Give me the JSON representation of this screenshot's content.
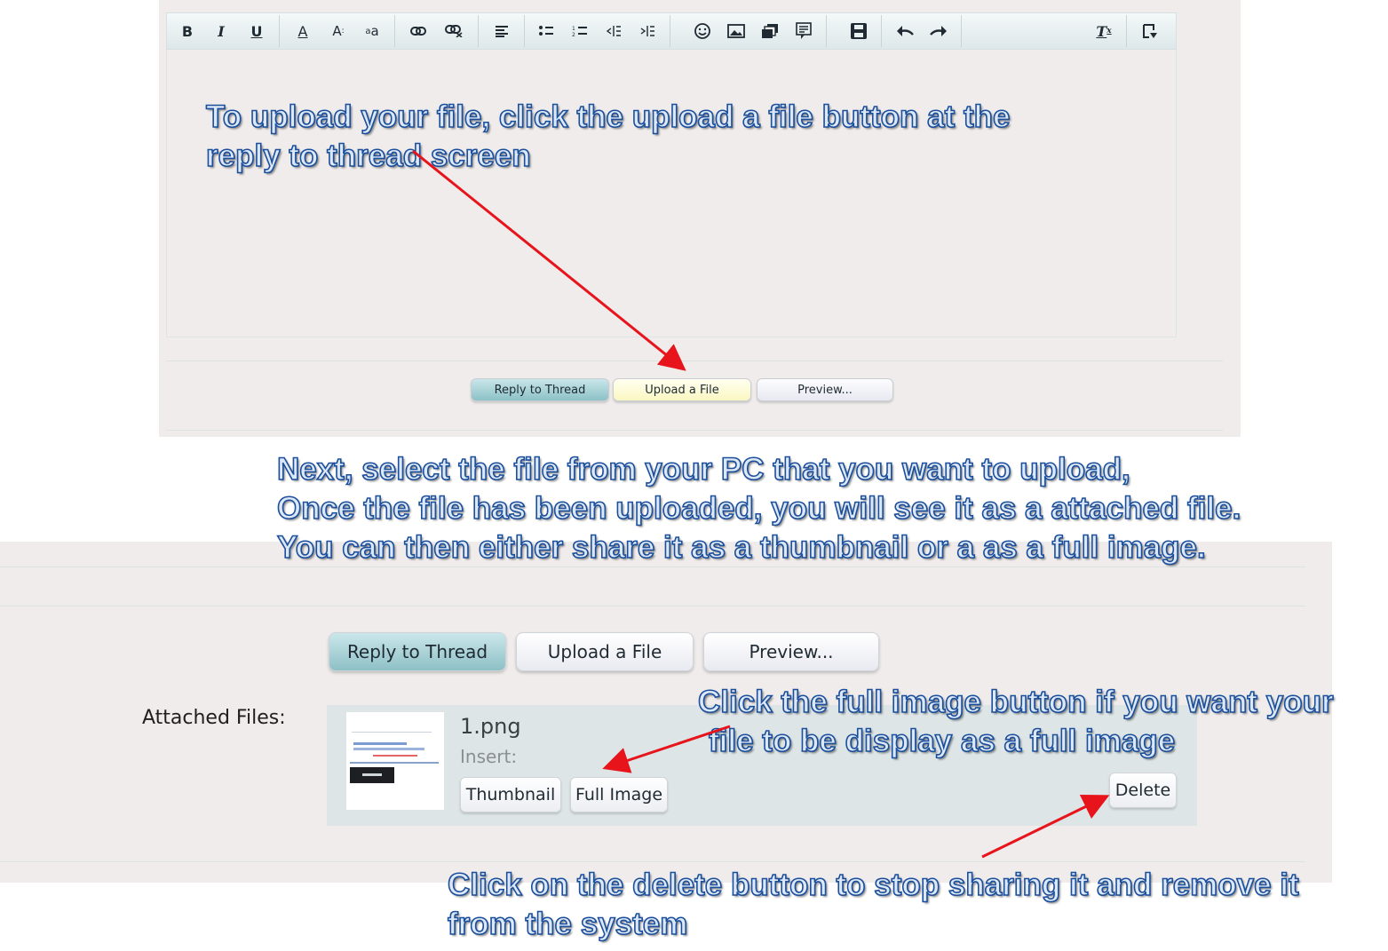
{
  "editor": {
    "toolbar": {
      "bold": "B",
      "italic": "I",
      "underline": "U",
      "font_color": "A",
      "font_size": "A",
      "text_case": "a",
      "remove_format": "T"
    },
    "buttons": {
      "reply": "Reply to Thread",
      "upload": "Upload a File",
      "preview": "Preview..."
    }
  },
  "attachments": {
    "buttons": {
      "reply": "Reply to Thread",
      "upload": "Upload a File",
      "preview": "Preview..."
    },
    "label": "Attached Files:",
    "file": {
      "name": "1.png",
      "insert_label": "Insert:",
      "thumbnail_button": "Thumbnail",
      "full_image_button": "Full Image",
      "delete_button": "Delete"
    }
  },
  "annotations": {
    "upload_step": {
      "line1": "To upload your file, click the upload a file button at the",
      "line2": "reply to thread screen"
    },
    "select_step": {
      "line1": "Next,  select the file from your PC that you want to upload,",
      "line2": "Once the file has been uploaded, you will see it as a attached file.",
      "line3": "You can then either share it as a thumbnail or a as a full image."
    },
    "full_image_step": {
      "line1": "Click the full image button if you want your",
      "line2": "file to be display as a full image"
    },
    "delete_step": {
      "line1": "Click on the delete button to stop sharing it and remove it",
      "line2": "from the system"
    }
  },
  "colors": {
    "arrow": "#e8141c",
    "annotation_text": "#dde8f7",
    "annotation_outline": "#1b4e9b",
    "panel_background": "#efeceb",
    "reply_button": "#8cc1c6",
    "upload_button_highlight": "#fbf7c2"
  }
}
